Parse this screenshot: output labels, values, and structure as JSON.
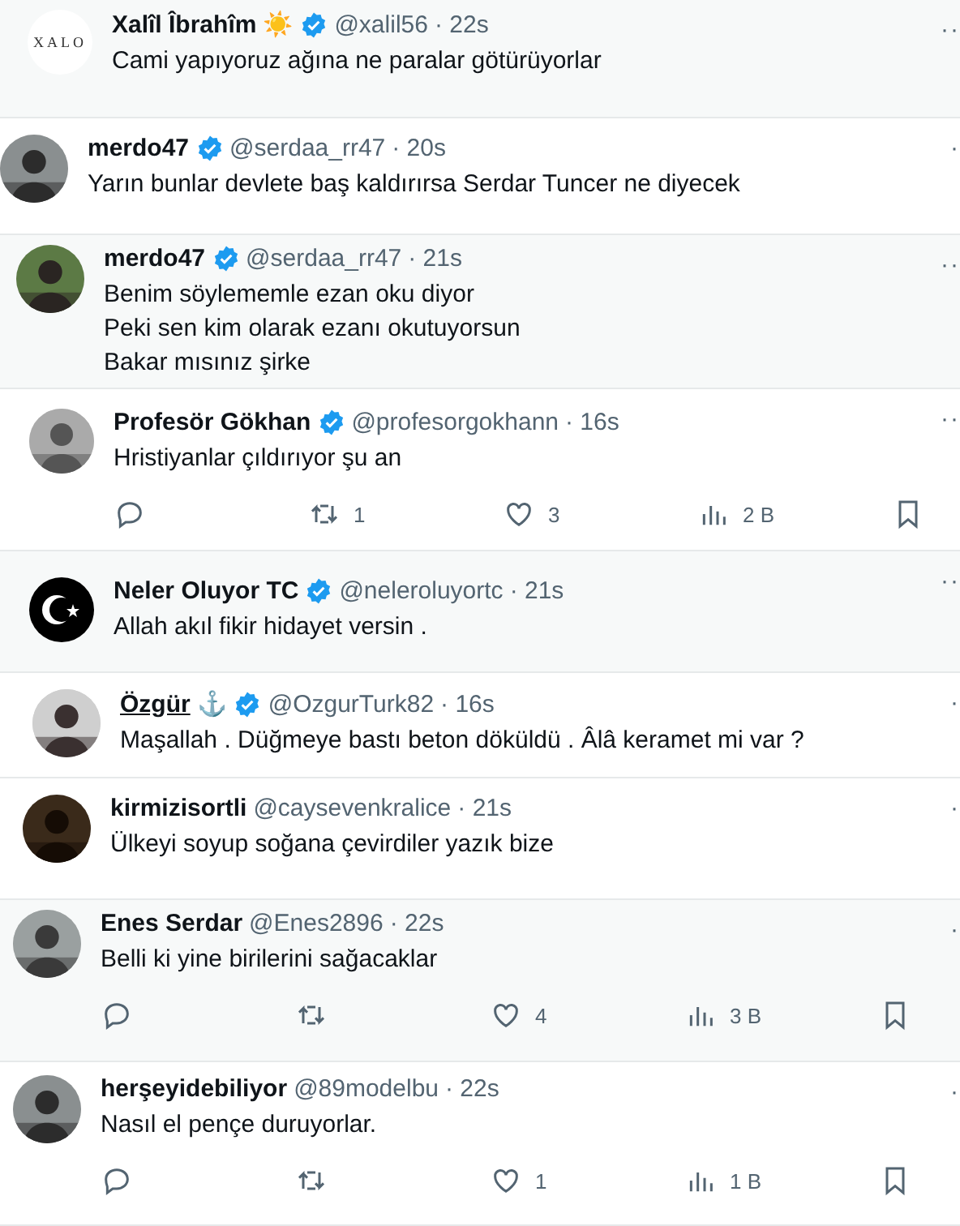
{
  "tweets": [
    {
      "name": "Xalîl Îbrahîm",
      "emoji": "☀️",
      "verified": true,
      "handle": "@xalil56",
      "time": "· 22s",
      "avatar": {
        "kind": "logo",
        "text": "XALO"
      },
      "lines": [
        "Cami yapıyoruz ağına ne paralar götürüyorlar"
      ],
      "more": "··"
    },
    {
      "name": "merdo47",
      "verified": true,
      "handle": "@serdaa_rr47",
      "time": "· 20s",
      "lines": [
        "Yarın bunlar devlete baş kaldırırsa Serdar Tuncer ne diyecek"
      ],
      "more": "·"
    },
    {
      "name": "merdo47",
      "verified": true,
      "handle": "@serdaa_rr47",
      "time": "· 21s",
      "lines": [
        "Benim söylememle ezan oku diyor",
        "Peki sen kim olarak ezanı okutuyorsun",
        "Bakar mısınız şirke"
      ],
      "more": "··"
    },
    {
      "name": "Profesör Gökhan",
      "verified": true,
      "handle": "@profesorgokhann",
      "time": "· 16s",
      "lines": [
        "Hristiyanlar çıldırıyor şu an"
      ],
      "more": "··",
      "actions": {
        "retweets": "1",
        "likes": "3",
        "views": "2 B"
      }
    },
    {
      "name": "Neler Oluyor TC",
      "verified": true,
      "handle": "@neleroluyortc",
      "time": "· 21s",
      "avatar": {
        "kind": "flag"
      },
      "lines": [
        "Allah akıl fikir hidayet versin ."
      ],
      "more": "··"
    },
    {
      "name": "Özgür",
      "emoji": "⚓",
      "underlined": true,
      "verified": true,
      "handle": "@OzgurTurk82",
      "time": "· 16s",
      "lines": [
        "Maşallah . Düğmeye bastı beton döküldü . Âlâ keramet mi var ?"
      ],
      "more": "·"
    },
    {
      "name": "kirmizisortli",
      "verified": false,
      "handle": "@caysevenkralice",
      "time": "· 21s",
      "lines": [
        "Ülkeyi soyup soğana çevirdiler yazık bize"
      ],
      "more": "·"
    },
    {
      "name": "Enes Serdar",
      "verified": false,
      "handle": "@Enes2896",
      "time": "· 22s",
      "lines": [
        "Belli ki yine birilerini sağacaklar"
      ],
      "more": "·",
      "actions": {
        "likes": "4",
        "views": "3 B"
      }
    },
    {
      "name": "herşeyidebiliyor",
      "verified": false,
      "handle": "@89modelbu",
      "time": "· 22s",
      "lines": [
        "Nasıl el pençe duruyorlar."
      ],
      "more": "·",
      "actions": {
        "likes": "1",
        "views": "1 B"
      }
    }
  ]
}
